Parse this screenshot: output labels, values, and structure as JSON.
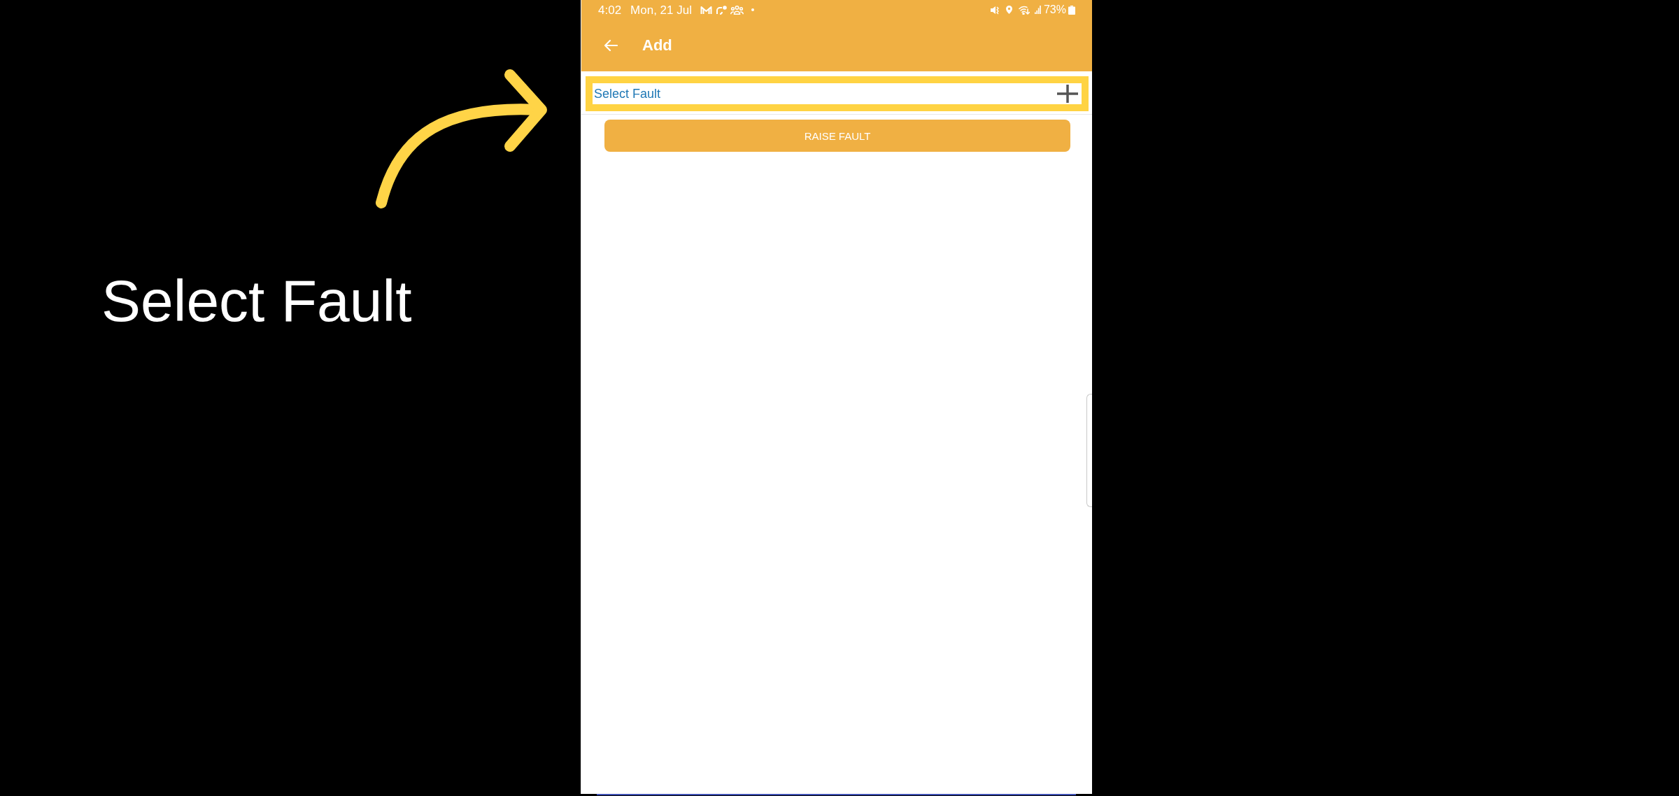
{
  "annotation": {
    "caption": "Select Fault"
  },
  "status_bar": {
    "time": "4:02",
    "date": "Mon, 21 Jul",
    "battery": "73%"
  },
  "app_bar": {
    "title": "Add"
  },
  "fault_picker": {
    "label": "Select Fault",
    "highlighted": true
  },
  "raise_button": {
    "label": "RAISE FAULT"
  }
}
